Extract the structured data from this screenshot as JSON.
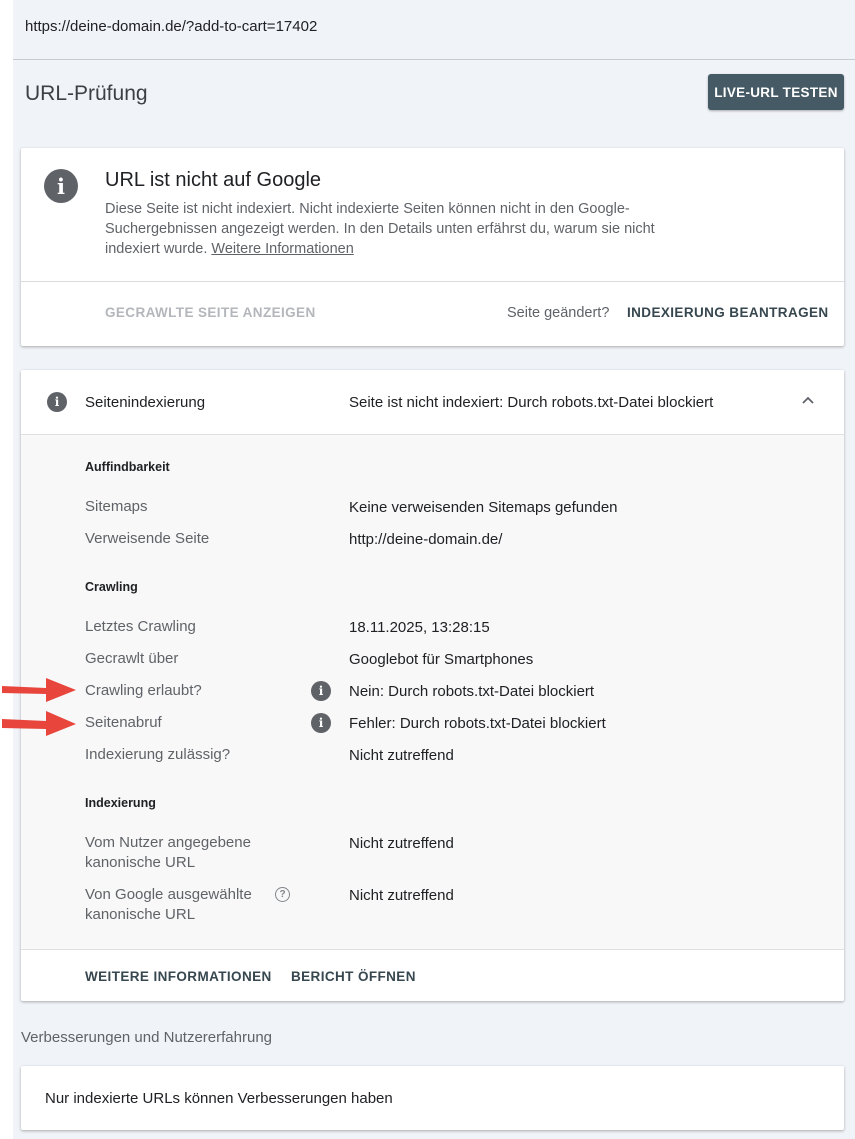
{
  "topbar": {
    "url": "https://deine-domain.de/?add-to-cart=17402"
  },
  "header": {
    "title": "URL-Prüfung",
    "live_test_label": "LIVE-URL TESTEN"
  },
  "status_card": {
    "icon": "info-icon",
    "title": "URL ist nicht auf Google",
    "description": "Diese Seite ist nicht indexiert. Nicht indexierte Seiten können nicht in den Google-Suchergebnissen angezeigt werden. In den Details unten erfährst du, warum sie nicht indexiert wurde.",
    "more_link": "Weitere Informationen",
    "crawled_page_label": "GECRAWLTE SEITE ANZEIGEN",
    "page_changed_text": "Seite geändert?",
    "request_indexing_label": "INDEXIERUNG BEANTRAGEN"
  },
  "indexing_card": {
    "title": "Seitenindexierung",
    "status": "Seite ist nicht indexiert: Durch robots.txt-Datei blockiert",
    "sections": {
      "discovery": {
        "heading": "Auffindbarkeit",
        "rows": [
          {
            "label": "Sitemaps",
            "value": "Keine verweisenden Sitemaps gefunden"
          },
          {
            "label": "Verweisende Seite",
            "value": "http://deine-domain.de/"
          }
        ]
      },
      "crawling": {
        "heading": "Crawling",
        "rows": [
          {
            "label": "Letztes Crawling",
            "value": "18.11.2025, 13:28:15"
          },
          {
            "label": "Gecrawlt über",
            "value": "Googlebot für Smartphones"
          },
          {
            "label": "Crawling erlaubt?",
            "value": "Nein: Durch robots.txt-Datei blockiert"
          },
          {
            "label": "Seitenabruf",
            "value": "Fehler: Durch robots.txt-Datei blockiert"
          },
          {
            "label": "Indexierung zulässig?",
            "value": "Nicht zutreffend"
          }
        ]
      },
      "indexing": {
        "heading": "Indexierung",
        "rows": [
          {
            "label_line1": "Vom Nutzer angegebene",
            "label_line2": "kanonische URL",
            "value": "Nicht zutreffend"
          },
          {
            "label_line1": "Von Google ausgewählte",
            "label_line2": "kanonische URL",
            "value": "Nicht zutreffend"
          }
        ]
      }
    },
    "footer": {
      "more_info_label": "WEITERE INFORMATIONEN",
      "open_report_label": "BERICHT ÖFFNEN"
    }
  },
  "enhancements": {
    "title": "Verbesserungen und Nutzererfahrung",
    "message": "Nur indexierte URLs können Verbesserungen haben"
  },
  "colors": {
    "accent_button": "#455a64",
    "arrow": "#e8453c",
    "icon_grey": "#5f6368"
  }
}
